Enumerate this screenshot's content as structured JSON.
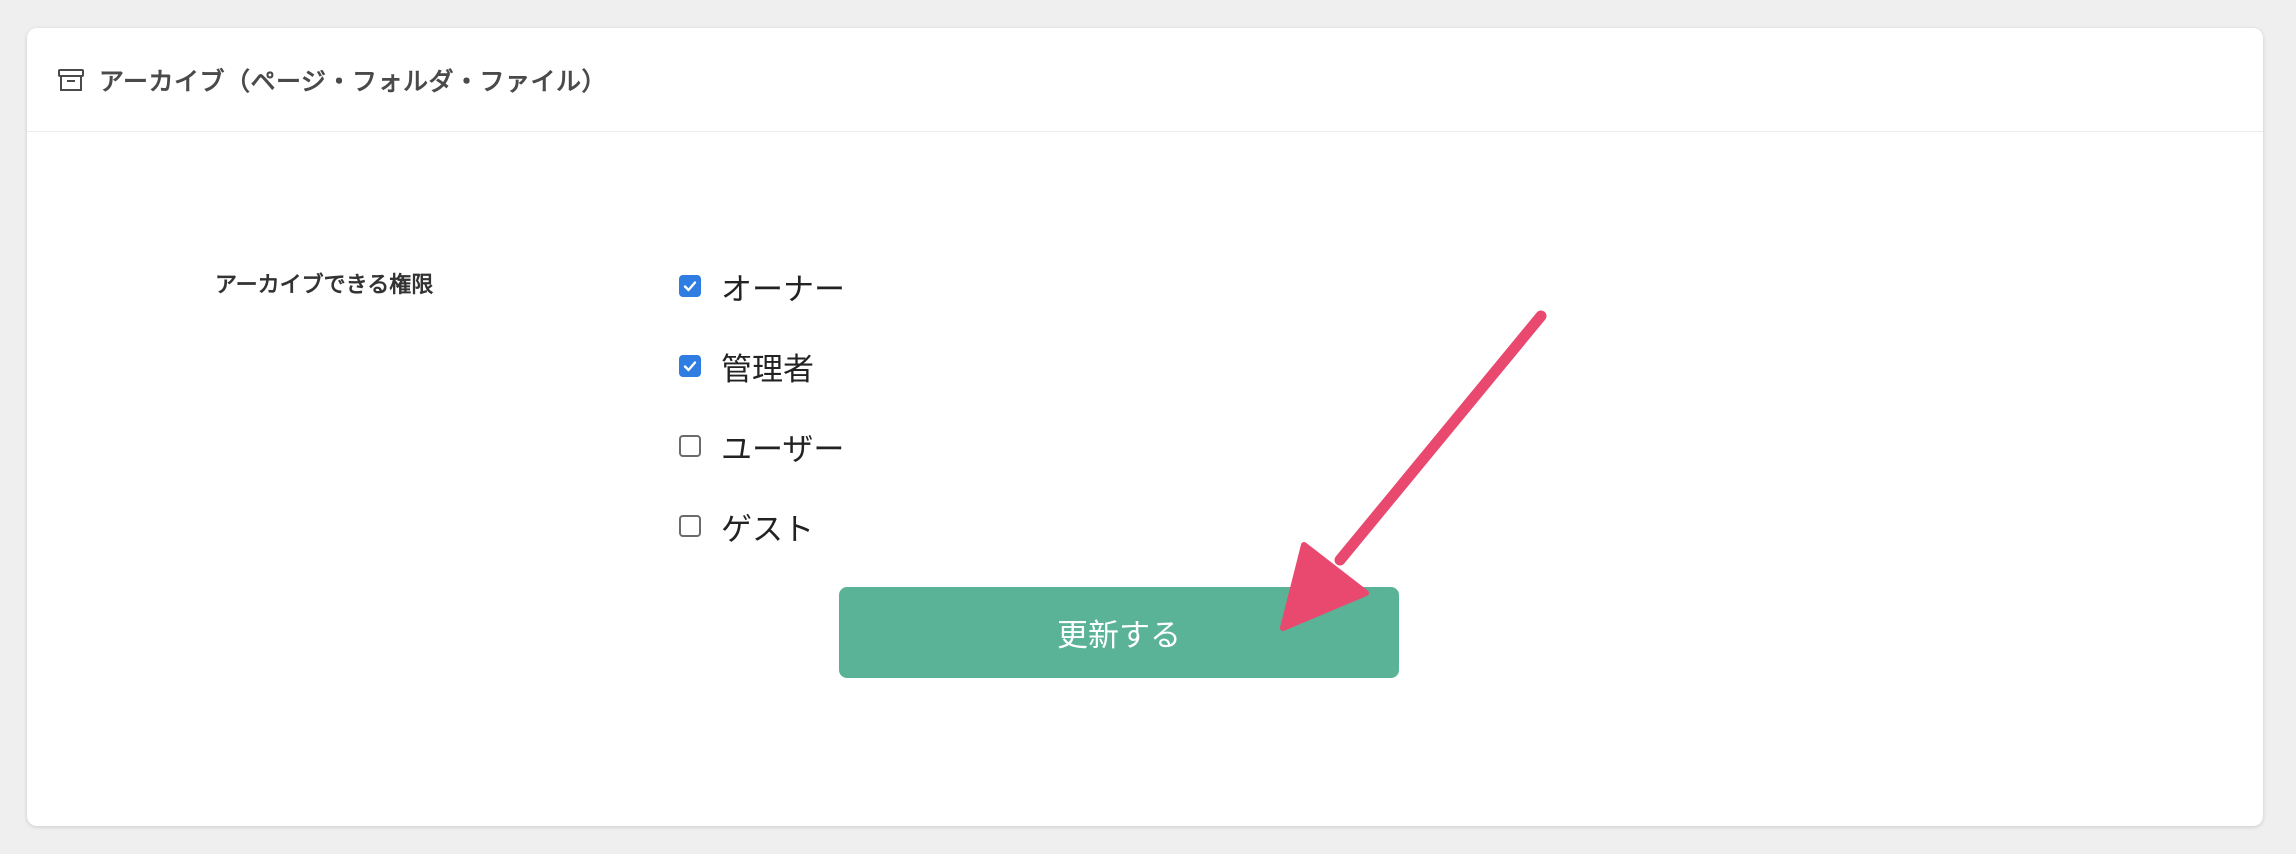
{
  "panel": {
    "title": "アーカイブ（ページ・フォルダ・ファイル）",
    "icon": "archive-icon"
  },
  "form": {
    "label": "アーカイブできる権限",
    "options": [
      {
        "label": "オーナー",
        "checked": true
      },
      {
        "label": "管理者",
        "checked": true
      },
      {
        "label": "ユーザー",
        "checked": false
      },
      {
        "label": "ゲスト",
        "checked": false
      }
    ],
    "submit_label": "更新する"
  },
  "colors": {
    "accent_button": "#5ab297",
    "checkbox_checked": "#2f7de1",
    "annotation_arrow": "#e9486f"
  }
}
